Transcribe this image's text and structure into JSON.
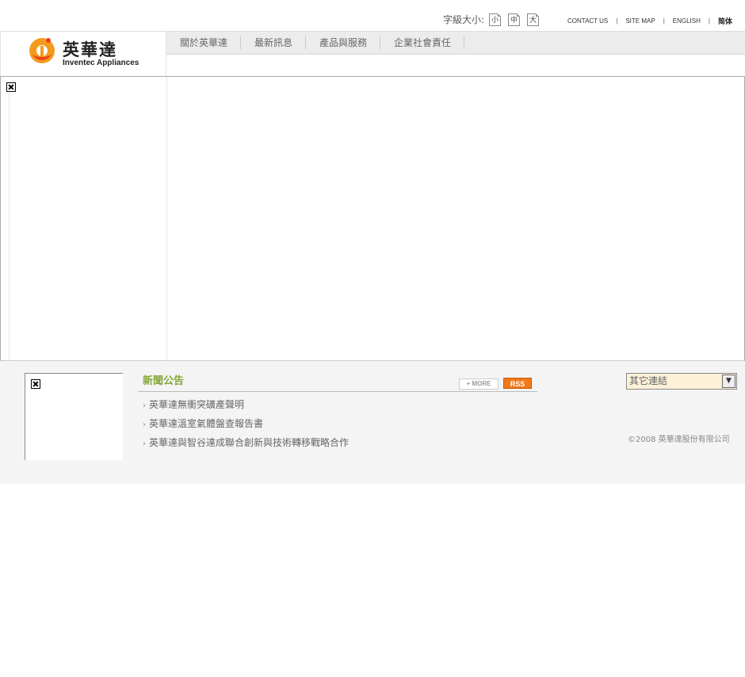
{
  "fontsize": {
    "label": "字級大小:",
    "options": [
      "小",
      "中",
      "大"
    ]
  },
  "toplinks": {
    "contact": "CONTACT US",
    "sitemap": "SITE MAP",
    "english": "ENGLISH",
    "simplified": "简体",
    "separator": "|"
  },
  "logo": {
    "cn": "英華達",
    "en": "Inventec Appliances"
  },
  "nav": {
    "items": [
      "關於英華達",
      "最新訊息",
      "產品與服務",
      "企業社會責任"
    ]
  },
  "news": {
    "title": "新聞公告",
    "more_label": "+ MORE",
    "rss_label": "RSS",
    "items": [
      "英華達無衝突礦產聲明",
      "英華達溫室氣體盤查報告書",
      "英華達與智谷達成聯合創新與技術轉移戰略合作"
    ]
  },
  "other_links": {
    "selected": "其它連結"
  },
  "copyright": "©2008 英華達股份有限公司",
  "colors": {
    "news_title": "#86a83a",
    "rss": "#f07a1a",
    "select_bg": "#fdf1d8"
  }
}
